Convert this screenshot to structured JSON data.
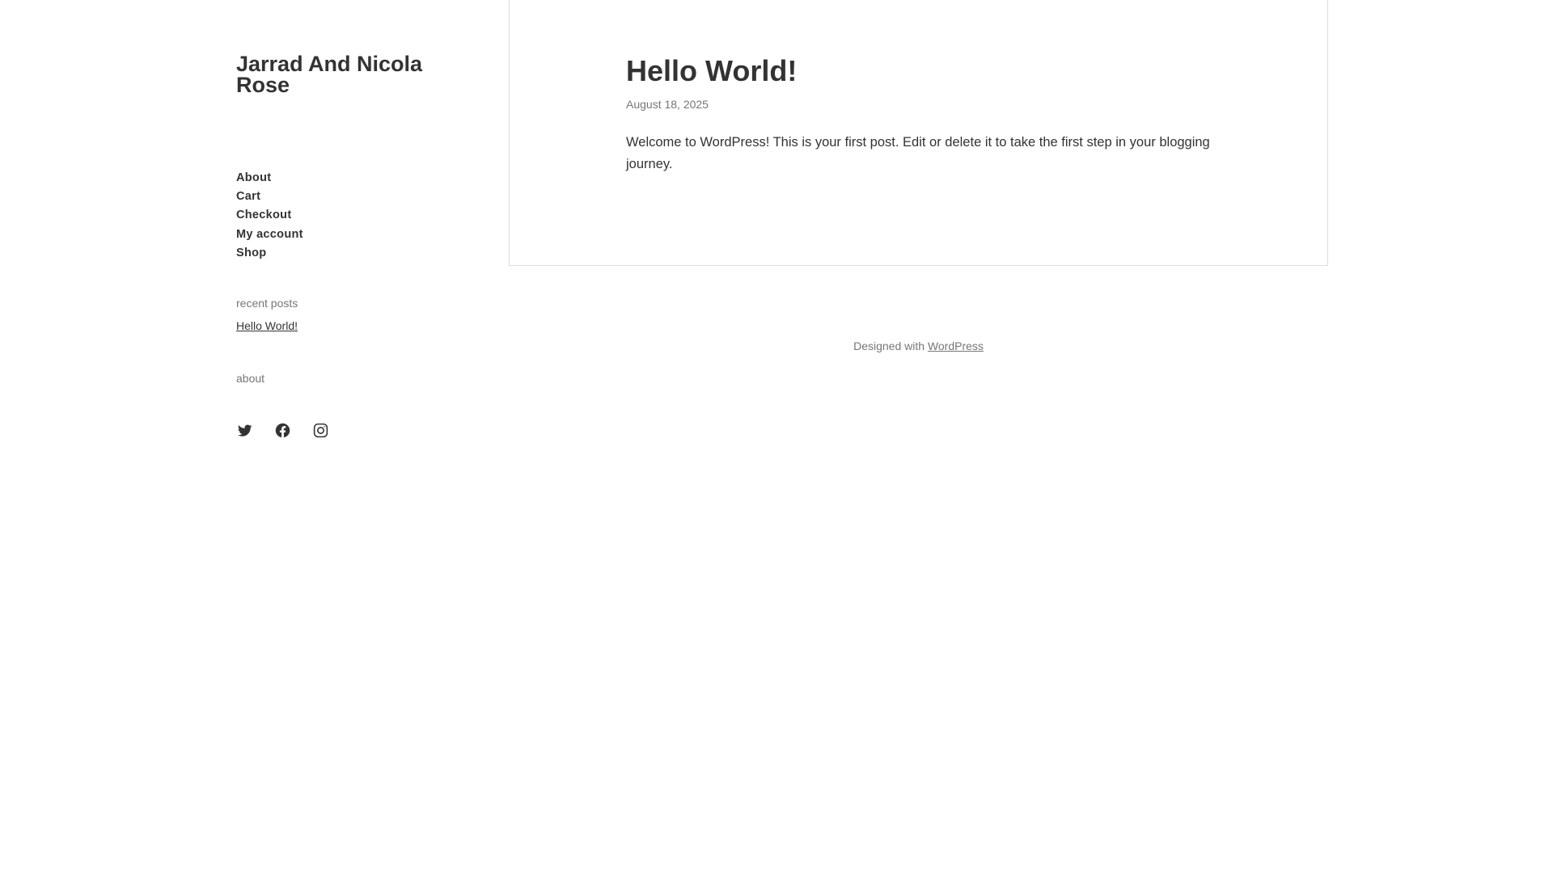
{
  "site": {
    "title": "Jarrad And Nicola Rose"
  },
  "nav": {
    "items": [
      {
        "label": "About"
      },
      {
        "label": "Cart"
      },
      {
        "label": "Checkout"
      },
      {
        "label": "My account"
      },
      {
        "label": "Shop"
      }
    ]
  },
  "widgets": {
    "recent_posts": {
      "title": "recent posts",
      "items": [
        {
          "label": "Hello World!"
        }
      ]
    },
    "about": {
      "title": "about"
    }
  },
  "social": {
    "icons": [
      "twitter-icon",
      "facebook-icon",
      "instagram-icon"
    ]
  },
  "post": {
    "title": "Hello World!",
    "date": "August 18, 2025",
    "content": "Welcome to WordPress! This is your first post. Edit or delete it to take the first step in your blogging journey."
  },
  "footer": {
    "prefix": "Designed with",
    "link_label": "WordPress"
  },
  "colors": {
    "text": "#333333",
    "muted": "#767676",
    "border": "#dddddd",
    "background": "#ffffff"
  }
}
